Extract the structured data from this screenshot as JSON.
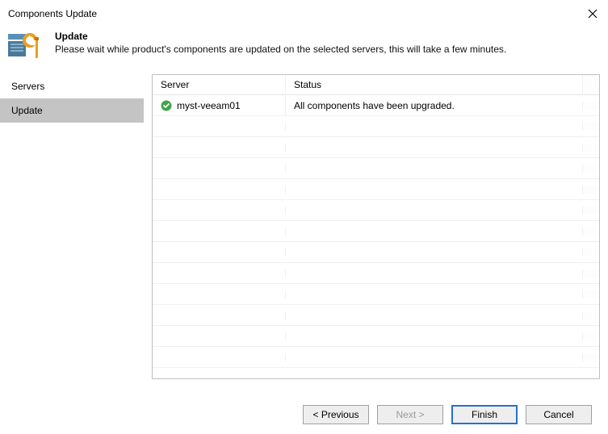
{
  "window": {
    "title": "Components Update"
  },
  "header": {
    "title": "Update",
    "subtitle": "Please wait while product's components are updated on the selected servers, this will take a few minutes."
  },
  "sidebar": {
    "items": [
      {
        "label": "Servers",
        "active": false
      },
      {
        "label": "Update",
        "active": true
      }
    ]
  },
  "table": {
    "columns": {
      "server": "Server",
      "status": "Status"
    },
    "rows": [
      {
        "server": "myst-veeam01",
        "status": "All components have been upgraded.",
        "icon": "success"
      }
    ],
    "empty_row_count": 12
  },
  "buttons": {
    "previous": "< Previous",
    "next": "Next >",
    "finish": "Finish",
    "cancel": "Cancel"
  }
}
